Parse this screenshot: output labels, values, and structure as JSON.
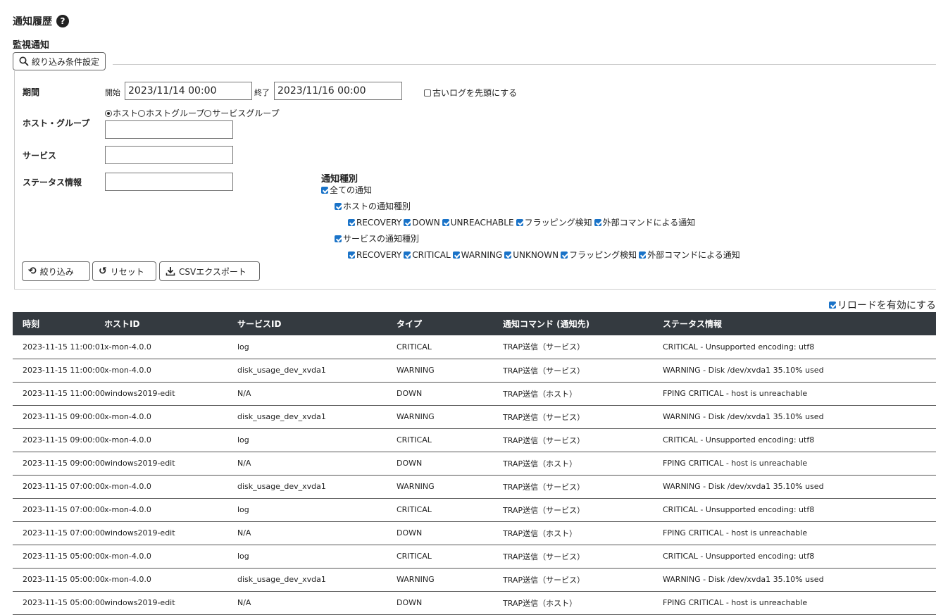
{
  "page": {
    "title": "通知履歴",
    "help_icon": "?",
    "section": "監視通知"
  },
  "filter_toggle": {
    "label": "絞り込み条件設定",
    "icon": "search-icon"
  },
  "filter": {
    "period": {
      "label": "期間",
      "start_label": "開始",
      "start_value": "2023/11/14 00:00",
      "end_label": "終了",
      "end_value": "2023/11/16 00:00",
      "old_first_label": "古いログを先頭にする",
      "old_first_checked": false
    },
    "host_group": {
      "label": "ホスト・グループ",
      "options": [
        "ホスト",
        "ホストグループ",
        "サービスグループ"
      ],
      "selected": "ホスト",
      "value": ""
    },
    "service": {
      "label": "サービス",
      "value": ""
    },
    "status": {
      "label": "ステータス情報",
      "value": ""
    },
    "notification_types": {
      "title": "通知種別",
      "all": "全ての通知",
      "host_group_label": "ホストの通知種別",
      "host_items": [
        "RECOVERY",
        "DOWN",
        "UNREACHABLE",
        "フラッピング検知",
        "外部コマンドによる通知"
      ],
      "service_group_label": "サービスの通知種別",
      "service_items": [
        "RECOVERY",
        "CRITICAL",
        "WARNING",
        "UNKNOWN",
        "フラッピング検知",
        "外部コマンドによる通知"
      ]
    }
  },
  "buttons": {
    "filter": "絞り込み",
    "reset": "リセット",
    "csv": "CSVエクスポート"
  },
  "reload_label": "リロードを有効にする",
  "table": {
    "headers": [
      "時刻",
      "ホストID",
      "サービスID",
      "タイプ",
      "通知コマンド (通知先)",
      "ステータス情報"
    ],
    "rows": [
      [
        "2023-11-15 11:00:01",
        "x-mon-4.0.0",
        "log",
        "CRITICAL",
        "TRAP送信（サービス）",
        "CRITICAL - Unsupported encoding: utf8"
      ],
      [
        "2023-11-15 11:00:00",
        "x-mon-4.0.0",
        "disk_usage_dev_xvda1",
        "WARNING",
        "TRAP送信（サービス）",
        "WARNING - Disk /dev/xvda1 35.10% used"
      ],
      [
        "2023-11-15 11:00:00",
        "windows2019-edit",
        "N/A",
        "DOWN",
        "TRAP送信（ホスト）",
        "FPING CRITICAL - host is unreachable"
      ],
      [
        "2023-11-15 09:00:00",
        "x-mon-4.0.0",
        "disk_usage_dev_xvda1",
        "WARNING",
        "TRAP送信（サービス）",
        "WARNING - Disk /dev/xvda1 35.10% used"
      ],
      [
        "2023-11-15 09:00:00",
        "x-mon-4.0.0",
        "log",
        "CRITICAL",
        "TRAP送信（サービス）",
        "CRITICAL - Unsupported encoding: utf8"
      ],
      [
        "2023-11-15 09:00:00",
        "windows2019-edit",
        "N/A",
        "DOWN",
        "TRAP送信（ホスト）",
        "FPING CRITICAL - host is unreachable"
      ],
      [
        "2023-11-15 07:00:00",
        "x-mon-4.0.0",
        "disk_usage_dev_xvda1",
        "WARNING",
        "TRAP送信（サービス）",
        "WARNING - Disk /dev/xvda1 35.10% used"
      ],
      [
        "2023-11-15 07:00:00",
        "x-mon-4.0.0",
        "log",
        "CRITICAL",
        "TRAP送信（サービス）",
        "CRITICAL - Unsupported encoding: utf8"
      ],
      [
        "2023-11-15 07:00:00",
        "windows2019-edit",
        "N/A",
        "DOWN",
        "TRAP送信（ホスト）",
        "FPING CRITICAL - host is unreachable"
      ],
      [
        "2023-11-15 05:00:00",
        "x-mon-4.0.0",
        "log",
        "CRITICAL",
        "TRAP送信（サービス）",
        "CRITICAL - Unsupported encoding: utf8"
      ],
      [
        "2023-11-15 05:00:00",
        "x-mon-4.0.0",
        "disk_usage_dev_xvda1",
        "WARNING",
        "TRAP送信（サービス）",
        "WARNING - Disk /dev/xvda1 35.10% used"
      ],
      [
        "2023-11-15 05:00:00",
        "windows2019-edit",
        "N/A",
        "DOWN",
        "TRAP送信（ホスト）",
        "FPING CRITICAL - host is unreachable"
      ]
    ]
  }
}
